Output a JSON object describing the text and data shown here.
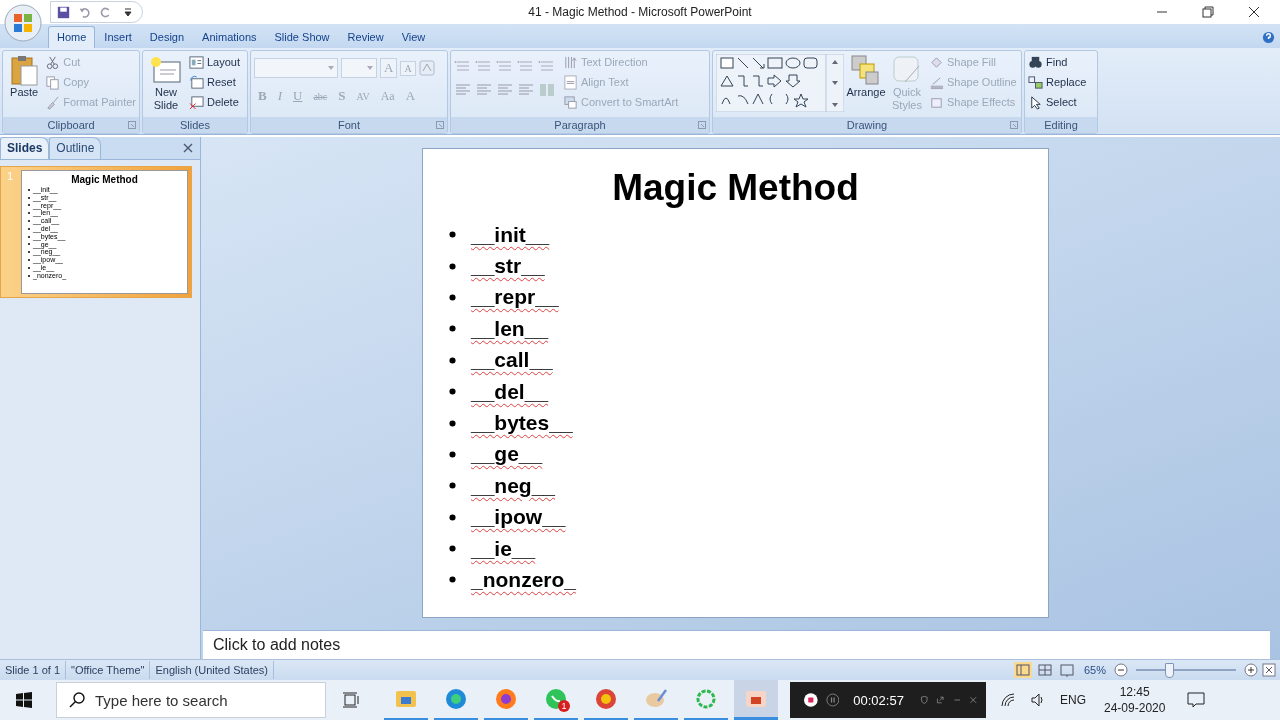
{
  "window": {
    "title": "41 - Magic Method - Microsoft PowerPoint"
  },
  "tabs": [
    {
      "label": "Home",
      "selected": true
    },
    {
      "label": "Insert",
      "selected": false
    },
    {
      "label": "Design",
      "selected": false
    },
    {
      "label": "Animations",
      "selected": false
    },
    {
      "label": "Slide Show",
      "selected": false
    },
    {
      "label": "Review",
      "selected": false
    },
    {
      "label": "View",
      "selected": false
    }
  ],
  "ribbon": [
    {
      "kind": "clipboard",
      "name": "Clipboard",
      "large": [
        {
          "label": "Paste",
          "disabled": false
        }
      ],
      "small": [
        {
          "label": "Cut",
          "disabled": true
        },
        {
          "label": "Copy",
          "disabled": true
        },
        {
          "label": "Format Painter",
          "disabled": true
        }
      ]
    },
    {
      "kind": "slides",
      "name": "Slides",
      "large": [
        {
          "label": "New Slide",
          "disabled": false
        }
      ],
      "small": [
        {
          "label": "Layout",
          "disabled": false
        },
        {
          "label": "Reset",
          "disabled": false
        },
        {
          "label": "Delete",
          "disabled": false
        }
      ]
    },
    {
      "kind": "font",
      "name": "Font",
      "size_buttons": [
        "A",
        "A"
      ],
      "glyphs": [
        "B",
        "I",
        "U",
        "abc",
        "S",
        "AV",
        "Aa",
        "A"
      ],
      "disabled": true
    },
    {
      "kind": "paragraph",
      "name": "Paragraph",
      "small": [
        {
          "label": "Text Direction",
          "disabled": true
        },
        {
          "label": "Align Text",
          "disabled": true
        },
        {
          "label": "Convert to SmartArt",
          "disabled": true
        }
      ]
    },
    {
      "kind": "drawing",
      "name": "Drawing",
      "large": [
        {
          "label": "Arrange",
          "disabled": false
        },
        {
          "label": "Quick Styles",
          "disabled": true
        }
      ],
      "small": [
        {
          "label": "Shape Fill",
          "disabled": true
        },
        {
          "label": "Shape Outline",
          "disabled": true
        },
        {
          "label": "Shape Effects",
          "disabled": true
        }
      ]
    },
    {
      "kind": "editing",
      "name": "Editing",
      "small": [
        {
          "label": "Find",
          "disabled": false
        },
        {
          "label": "Replace",
          "disabled": false
        },
        {
          "label": "Select",
          "disabled": false
        }
      ]
    }
  ],
  "panel": {
    "tabs": [
      {
        "label": "Slides",
        "selected": true
      },
      {
        "label": "Outline",
        "selected": false
      }
    ],
    "thumbnails": [
      {
        "number": "1",
        "selected": true,
        "title": "Magic Method",
        "bullets": [
          "__init__",
          "__str__",
          "__repr__",
          "__len__",
          "__call__",
          "__del__",
          "__bytes__",
          "__ge__",
          "__neg__",
          "__ipow__",
          "__ie__",
          "_nonzero_"
        ]
      }
    ]
  },
  "slide": {
    "title": "Magic Method",
    "bullets": [
      "__init__",
      "__str__",
      "__repr__",
      "__len__",
      "__call__",
      "__del__",
      "__bytes__",
      "__ge__",
      "__neg__",
      "__ipow__",
      "__ie__",
      "_nonzero_"
    ]
  },
  "notes": {
    "placeholder": "Click to add notes"
  },
  "status_bar": {
    "items": [
      "Slide 1 of 1",
      "\"Office Theme\"",
      "English (United States)"
    ],
    "views": [
      {
        "selected": true
      },
      {
        "selected": false
      },
      {
        "selected": false
      }
    ],
    "zoom": "65%",
    "zoom_level": {
      "level": 0.33
    }
  },
  "taskbar": {
    "search_placeholder": "Type here to search",
    "apps": [
      {
        "kind": "explorer",
        "running": true,
        "selected": false
      },
      {
        "kind": "edge",
        "running": true,
        "selected": false
      },
      {
        "kind": "firefox",
        "running": true,
        "selected": false
      },
      {
        "kind": "chat",
        "running": true,
        "selected": false,
        "badge": "1"
      },
      {
        "kind": "chrome",
        "running": true,
        "selected": false
      },
      {
        "kind": "paint",
        "running": true,
        "selected": false
      },
      {
        "kind": "ring",
        "running": true,
        "selected": false
      },
      {
        "kind": "powerpoint",
        "running": true,
        "selected": true
      }
    ],
    "recorder": {
      "time": "00:02:57"
    },
    "language": "ENG",
    "time": "12:45",
    "date": "24-09-2020"
  }
}
